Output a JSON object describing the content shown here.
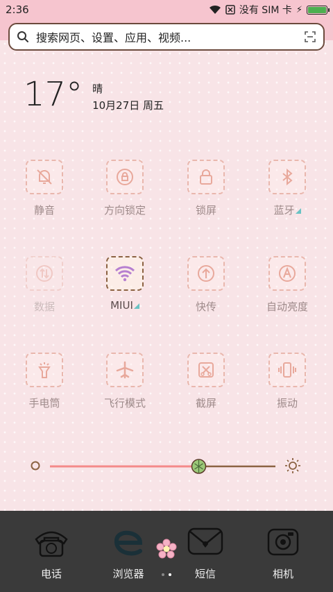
{
  "status": {
    "time": "2:36",
    "carrier": "没有 SIM 卡",
    "battery_level": 1.0
  },
  "search": {
    "placeholder": "搜索网页、设置、应用、视频..."
  },
  "weather": {
    "temp": "17°",
    "condition": "晴",
    "date": "10月27日 周五"
  },
  "tiles": [
    {
      "label": "静音",
      "icon": "mute-bell-icon",
      "state": "off"
    },
    {
      "label": "方向锁定",
      "icon": "rotation-lock-icon",
      "state": "off"
    },
    {
      "label": "锁屏",
      "icon": "lock-icon",
      "state": "off"
    },
    {
      "label": "蓝牙",
      "icon": "bluetooth-icon",
      "state": "off",
      "has_more": true
    },
    {
      "label": "数据",
      "icon": "mobile-data-icon",
      "state": "disabled"
    },
    {
      "label": "MIUI",
      "icon": "wifi-icon",
      "state": "on",
      "has_more": true
    },
    {
      "label": "快传",
      "icon": "transfer-icon",
      "state": "off"
    },
    {
      "label": "自动亮度",
      "icon": "auto-brightness-icon",
      "state": "off"
    },
    {
      "label": "手电筒",
      "icon": "flashlight-icon",
      "state": "off"
    },
    {
      "label": "飞行模式",
      "icon": "airplane-icon",
      "state": "off"
    },
    {
      "label": "截屏",
      "icon": "screenshot-icon",
      "state": "off"
    },
    {
      "label": "振动",
      "icon": "vibrate-icon",
      "state": "off"
    }
  ],
  "brightness": {
    "value": 0.66
  },
  "dock": [
    {
      "label": "电话",
      "icon": "phone-icon"
    },
    {
      "label": "浏览器",
      "icon": "browser-icon"
    },
    {
      "label": "短信",
      "icon": "messages-icon"
    },
    {
      "label": "相机",
      "icon": "camera-icon"
    }
  ],
  "page_indicator": {
    "count": 2,
    "current": 2
  },
  "colors": {
    "accent": "#f6c5cf",
    "active_border": "#8b6242",
    "tile_border": "#e9b7ad",
    "slider_track": "#f48a8a",
    "dock_bg": "#3a3a3a"
  }
}
